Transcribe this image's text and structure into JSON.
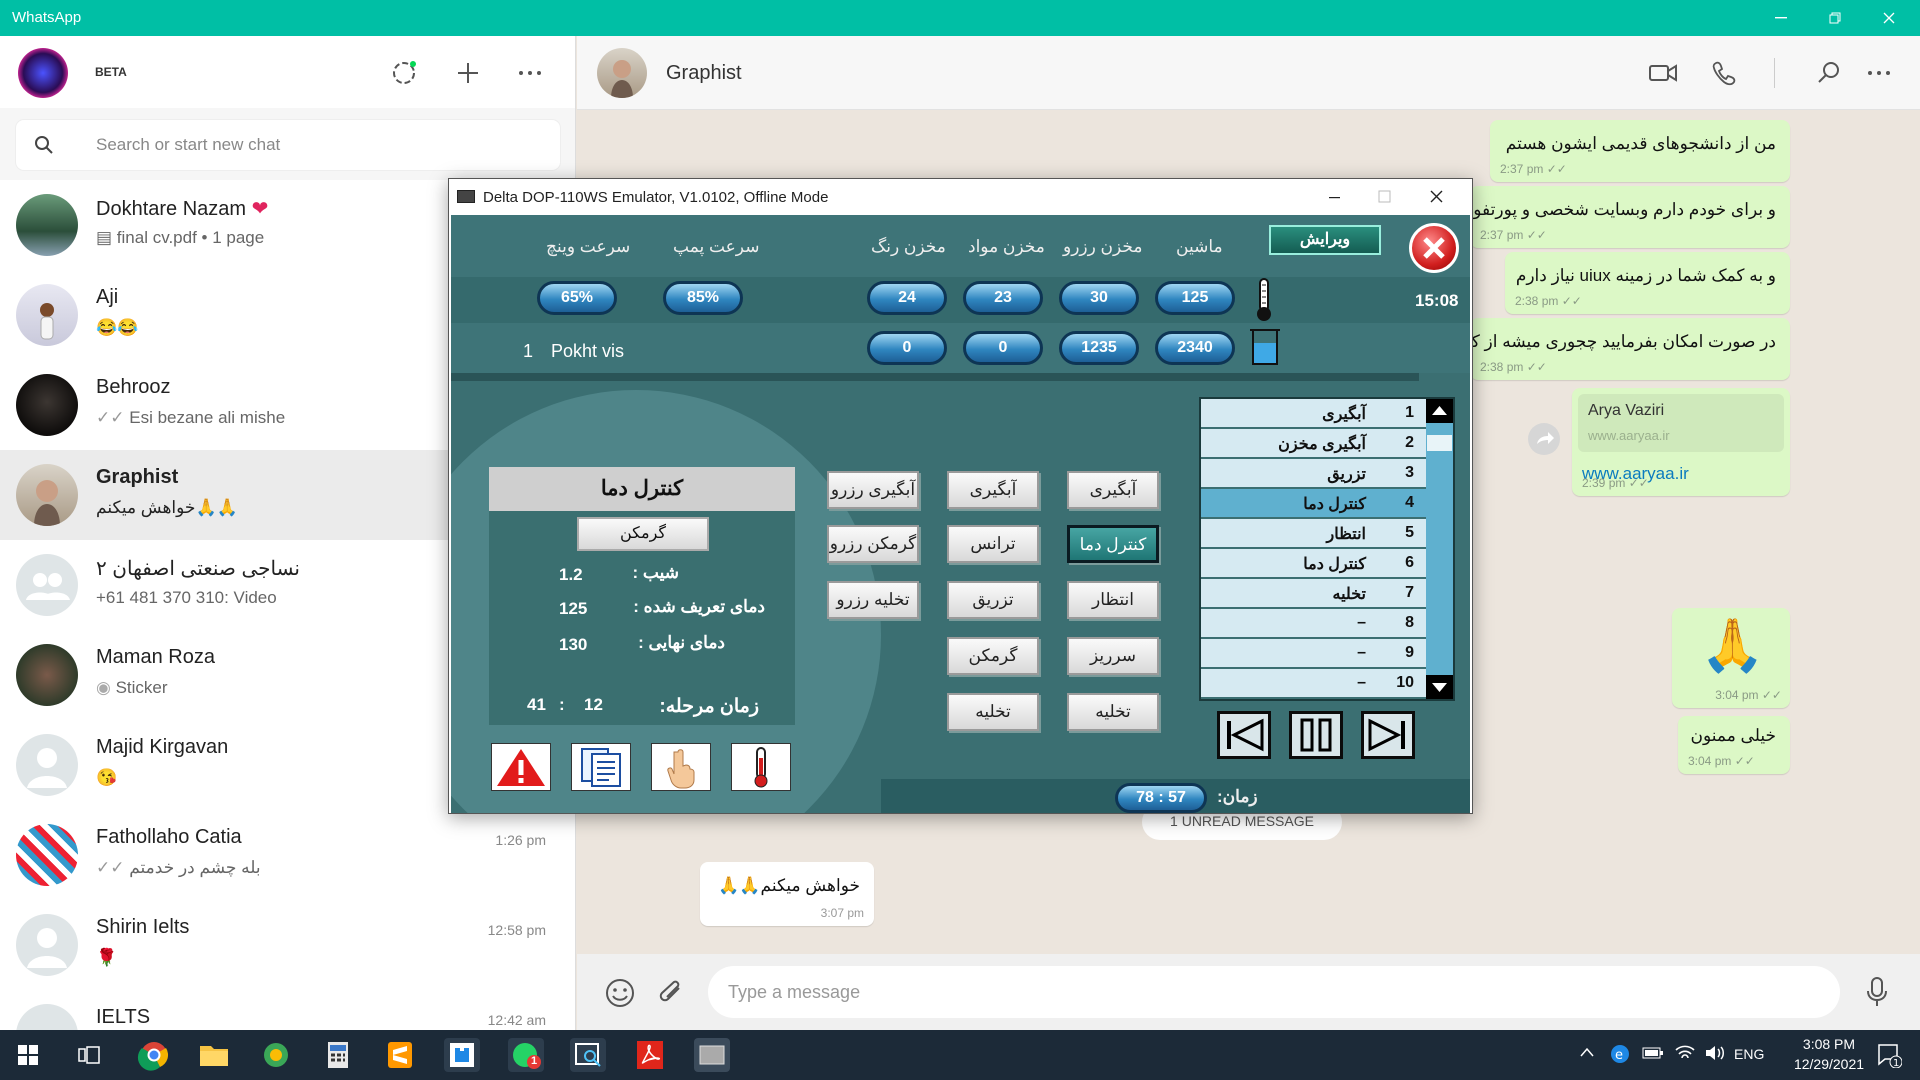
{
  "window": {
    "title": "WhatsApp"
  },
  "left": {
    "beta": "BETA",
    "search_placeholder": "Search or start new chat",
    "chats": [
      {
        "name": "Dokhtare Nazam",
        "msg": "final cv.pdf • 1 page",
        "time": ""
      },
      {
        "name": "Aji",
        "msg": "😂😂",
        "time": ""
      },
      {
        "name": "Behrooz",
        "msg": "Esi bezane ali mishe",
        "time": ""
      },
      {
        "name": "Graphist",
        "msg": "خواهش میکنم🙏🙏",
        "time": ""
      },
      {
        "name": "نساجی صنعتی اصفهان ۲",
        "msg": "+61 481 370 310: Video",
        "time": ""
      },
      {
        "name": "Maman Roza",
        "msg": "Sticker",
        "time": ""
      },
      {
        "name": "Majid Kirgavan",
        "msg": "😘",
        "time": ""
      },
      {
        "name": "Fathollaho Catia",
        "msg": "بله چشم در خدمتم",
        "time": "1:26 pm"
      },
      {
        "name": "Shirin Ielts",
        "msg": "🌹",
        "time": "12:58 pm"
      },
      {
        "name": "IELTS",
        "msg": "",
        "time": "12:42 am"
      }
    ]
  },
  "chat": {
    "contact": "Graphist",
    "messages": [
      {
        "text": "من از دانشجوهای قدیمی ایشون هستم",
        "time": "2:37 pm"
      },
      {
        "text": "و برای خودم دارم وبسایت شخصی و پورتفولیو",
        "time": "2:37 pm"
      },
      {
        "text": "و به کمک شما در زمینه uiux نیاز دارم",
        "time": "2:38 pm"
      },
      {
        "text": "در صورت امکان بفرمایید چجوری میشه از کمک",
        "time": "2:38 pm"
      }
    ],
    "link_preview": {
      "title": "Arya Vaziri",
      "domain": "www.aaryaa.ir",
      "link": "www.aaryaa.ir",
      "time": "2:39 pm"
    },
    "emoji_msg": {
      "text": "🙏",
      "time": "3:04 pm"
    },
    "thanks": {
      "text": "خیلی ممنون",
      "time": "3:04 pm"
    },
    "unread": "1 UNREAD MESSAGE",
    "incoming": {
      "text": "خواهش میکنم🙏🙏",
      "time": "3:07 pm"
    },
    "composer_placeholder": "Type a message"
  },
  "emulator": {
    "title": "Delta DOP-110WS Emulator, V1.0102, Offline Mode",
    "edit": "ویرایش",
    "headers": {
      "winch": "سرعت وینچ",
      "pump": "سرعت پمپ",
      "color": "مخزن رنگ",
      "material": "مخزن مواد",
      "reserve": "مخزن رزرو",
      "machine": "ماشین"
    },
    "row1": {
      "winch": "65%",
      "pump": "85%",
      "color": "24",
      "material": "23",
      "reserve": "30",
      "machine": "125"
    },
    "row2": {
      "color": "0",
      "material": "0",
      "reserve": "1235",
      "machine": "2340"
    },
    "clock": "15:08",
    "program_no": "1",
    "program_name": "Pokht vis",
    "panel": {
      "title": "کنترل دما",
      "mode": "گرمکن",
      "slope_label": "شیب :",
      "slope": "1.2",
      "set_label": "دمای تعریف شده :",
      "set": "125",
      "final_label": "دمای نهایی :",
      "final": "130",
      "stage_label": "زمان مرحله:",
      "stage_min": "12",
      "stage_sep": ":",
      "stage_sec": "41"
    },
    "buttons": {
      "c1": [
        "آبگیری",
        "کنترل دما",
        "انتظار",
        "سرریز",
        "تخلیه"
      ],
      "c2": [
        "آبگیری",
        "ترانس",
        "تزریق",
        "گرمکن",
        "تخلیه"
      ],
      "c3": [
        "آبگیری رزرو",
        "گرمکن رزرو",
        "تخلیه رزرو"
      ]
    },
    "steps": [
      {
        "n": "1",
        "label": "آبگیری"
      },
      {
        "n": "2",
        "label": "آبگیری مخزن"
      },
      {
        "n": "3",
        "label": "تزریق"
      },
      {
        "n": "4",
        "label": "کنترل دما"
      },
      {
        "n": "5",
        "label": "انتظار"
      },
      {
        "n": "6",
        "label": "کنترل دما"
      },
      {
        "n": "7",
        "label": "تخلیه"
      },
      {
        "n": "8",
        "label": "–"
      },
      {
        "n": "9",
        "label": "–"
      },
      {
        "n": "10",
        "label": "–"
      }
    ],
    "time_label": "زمان:",
    "time_value": "78 : 57"
  },
  "taskbar": {
    "lang": "ENG",
    "time": "3:08 PM",
    "date": "12/29/2021",
    "badge": "1"
  },
  "colors": {
    "accent": "#00bfa5",
    "bubble": "#dcf8c6",
    "hmi_bg": "#3b6f72"
  }
}
